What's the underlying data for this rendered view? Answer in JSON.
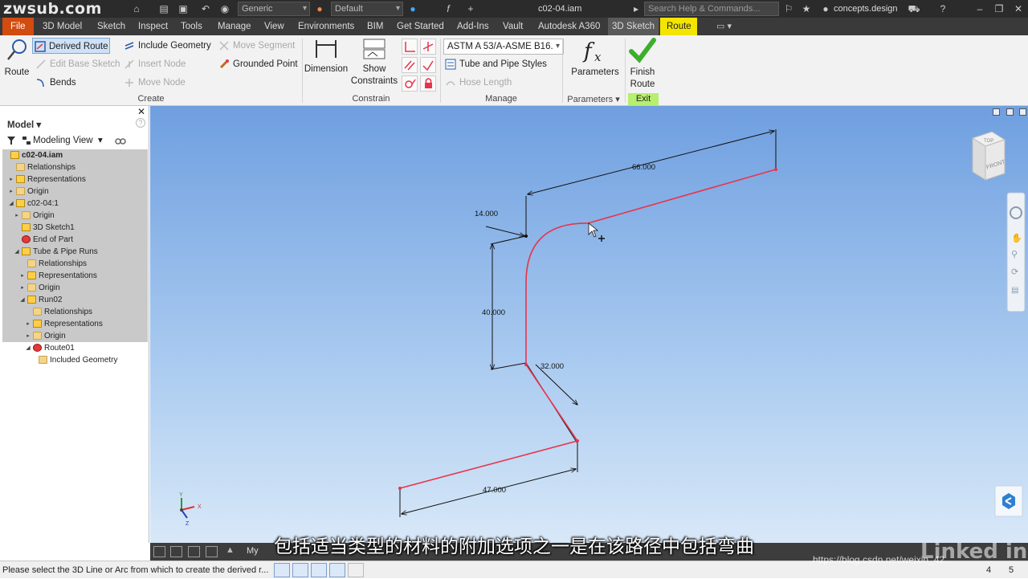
{
  "titlebar": {
    "site_mark": "zwsub.com",
    "appearance_dropdown": "Generic",
    "material_dropdown": "Default",
    "doc_title": "c02-04.iam",
    "search_placeholder": "Search Help & Commands...",
    "user_name": "concepts.design"
  },
  "tabs": [
    {
      "label": "File"
    },
    {
      "label": "3D Model"
    },
    {
      "label": "Sketch"
    },
    {
      "label": "Inspect"
    },
    {
      "label": "Tools"
    },
    {
      "label": "Manage"
    },
    {
      "label": "View"
    },
    {
      "label": "Environments"
    },
    {
      "label": "BIM"
    },
    {
      "label": "Get Started"
    },
    {
      "label": "Add-Ins"
    },
    {
      "label": "Vault"
    },
    {
      "label": "Autodesk A360"
    },
    {
      "label": "3D Sketch"
    },
    {
      "label": "Route"
    }
  ],
  "ribbon": {
    "route_label": "Route",
    "derived_route": "Derived Route",
    "include_geometry": "Include Geometry",
    "move_segment": "Move Segment",
    "edit_base_sketch": "Edit Base Sketch",
    "insert_node": "Insert Node",
    "grounded_point": "Grounded Point",
    "bends": "Bends",
    "move_node": "Move Node",
    "create_group": "Create",
    "dimension": "Dimension",
    "show_constraints_1": "Show",
    "show_constraints_2": "Constraints",
    "constrain_group": "Constrain",
    "style_combo": "ASTM A 53/A-ASME B16.",
    "tube_pipe_styles": "Tube and Pipe Styles",
    "hose_length": "Hose Length",
    "manage_group": "Manage",
    "parameters": "Parameters",
    "parameters_group": "Parameters",
    "finish_route_1": "Finish",
    "finish_route_2": "Route",
    "exit_group": "Exit"
  },
  "browser": {
    "header": "Model",
    "view_label": "Modeling View",
    "tree": [
      {
        "label": "c02-04.iam",
        "indent": 0,
        "arrow": "",
        "icon": "assembly",
        "bold": true,
        "selected": true
      },
      {
        "label": "Relationships",
        "indent": 1,
        "arrow": "",
        "icon": "folder",
        "selected": true
      },
      {
        "label": "Representations",
        "indent": 1,
        "arrow": "▸",
        "icon": "reps",
        "selected": true
      },
      {
        "label": "Origin",
        "indent": 1,
        "arrow": "▸",
        "icon": "folder",
        "selected": true
      },
      {
        "label": "c02-04:1",
        "indent": 1,
        "arrow": "◢",
        "icon": "part",
        "selected": true
      },
      {
        "label": "Origin",
        "indent": 2,
        "arrow": "▸",
        "icon": "folder",
        "selected": true
      },
      {
        "label": "3D Sketch1",
        "indent": 2,
        "arrow": "",
        "icon": "sketch",
        "selected": true
      },
      {
        "label": "End of Part",
        "indent": 2,
        "arrow": "",
        "icon": "eop",
        "selected": true
      },
      {
        "label": "Tube & Pipe Runs",
        "indent": 2,
        "arrow": "◢",
        "icon": "runs",
        "selected": true
      },
      {
        "label": "Relationships",
        "indent": 3,
        "arrow": "",
        "icon": "folder",
        "selected": true
      },
      {
        "label": "Representations",
        "indent": 3,
        "arrow": "▸",
        "icon": "reps",
        "selected": true
      },
      {
        "label": "Origin",
        "indent": 3,
        "arrow": "▸",
        "icon": "folder",
        "selected": true
      },
      {
        "label": "Run02",
        "indent": 3,
        "arrow": "◢",
        "icon": "run",
        "selected": true
      },
      {
        "label": "Relationships",
        "indent": 4,
        "arrow": "",
        "icon": "folder",
        "selected": true
      },
      {
        "label": "Representations",
        "indent": 4,
        "arrow": "▸",
        "icon": "reps",
        "selected": true
      },
      {
        "label": "Origin",
        "indent": 4,
        "arrow": "▸",
        "icon": "folder",
        "selected": true
      },
      {
        "label": "Route01",
        "indent": 4,
        "arrow": "◢",
        "icon": "route",
        "selected": false
      },
      {
        "label": "Included Geometry",
        "indent": 5,
        "arrow": "",
        "icon": "folder",
        "selected": false
      }
    ]
  },
  "viewport": {
    "dimensions": {
      "d66": "66.000",
      "d14": "14.000",
      "d40": "40.000",
      "d32": "32.000",
      "d47": "47.000"
    },
    "viewcube_top": "TOP",
    "viewcube_front": "FRONT",
    "route_color": "#e8344a",
    "dim_color": "#111111"
  },
  "statusbar": {
    "message": "Please select the 3D Line or Arc from which to create the derived r...",
    "page_a": "4",
    "page_b": "5"
  },
  "overlay": {
    "subtitle": "包括适当类型的材料的附加选项之一是在该路径中包括弯曲",
    "watermark": "https://blog.csdn.net/weixin_42...",
    "brand": "Linked in"
  }
}
